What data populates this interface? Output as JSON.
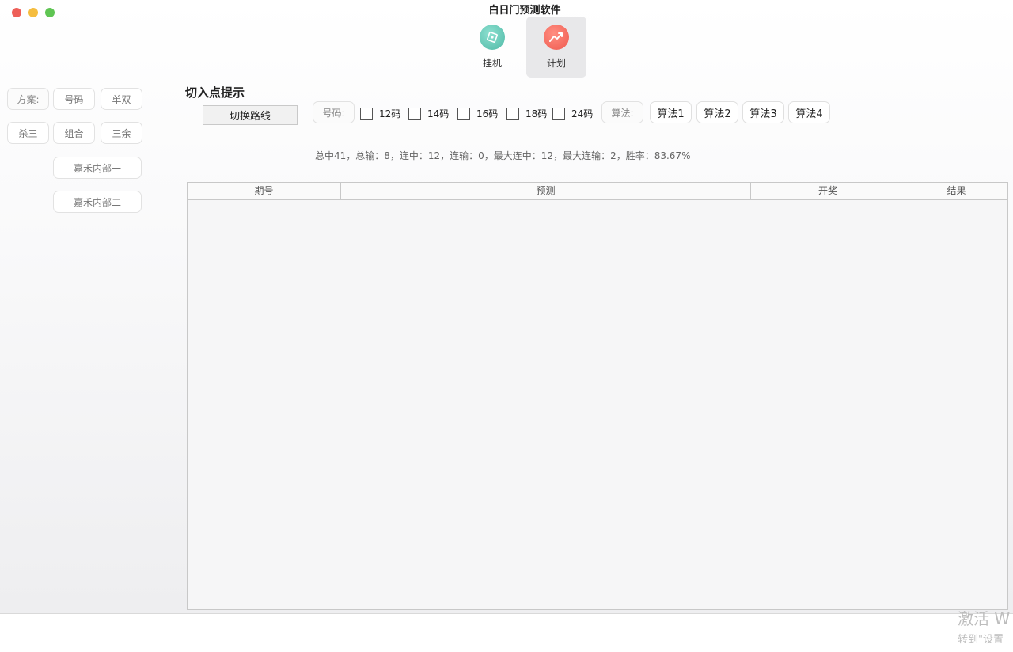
{
  "app": {
    "title": "白日门预测软件"
  },
  "toolbar": {
    "items": [
      {
        "label": "挂机",
        "icon": "compass-icon"
      },
      {
        "label": "计划",
        "icon": "trend-chart-icon"
      }
    ],
    "active": "计划"
  },
  "sidebar": {
    "row1": [
      "方案:",
      "号码",
      "单双"
    ],
    "row2": [
      "杀三",
      "组合",
      "三余"
    ],
    "internal": [
      "嘉禾内部一",
      "嘉禾内部二"
    ]
  },
  "main": {
    "section_title": "切入点提示",
    "switch_label": "切换路线",
    "haoma_label": "号码:",
    "checkboxes": [
      "12码",
      "14码",
      "16码",
      "18码",
      "24码"
    ],
    "suanfa_label": "算法:",
    "algorithms": [
      "算法1",
      "算法2",
      "算法3",
      "算法4"
    ],
    "stats": "总中41，总输：8，连中：12，连输：0，最大连中：12，最大连输：2，胜率：83.67%"
  },
  "table": {
    "headers": [
      "期号",
      "预测",
      "开奖",
      "结果"
    ]
  },
  "watermark": {
    "line1": "激活 W",
    "line2": "转到\"设置"
  }
}
